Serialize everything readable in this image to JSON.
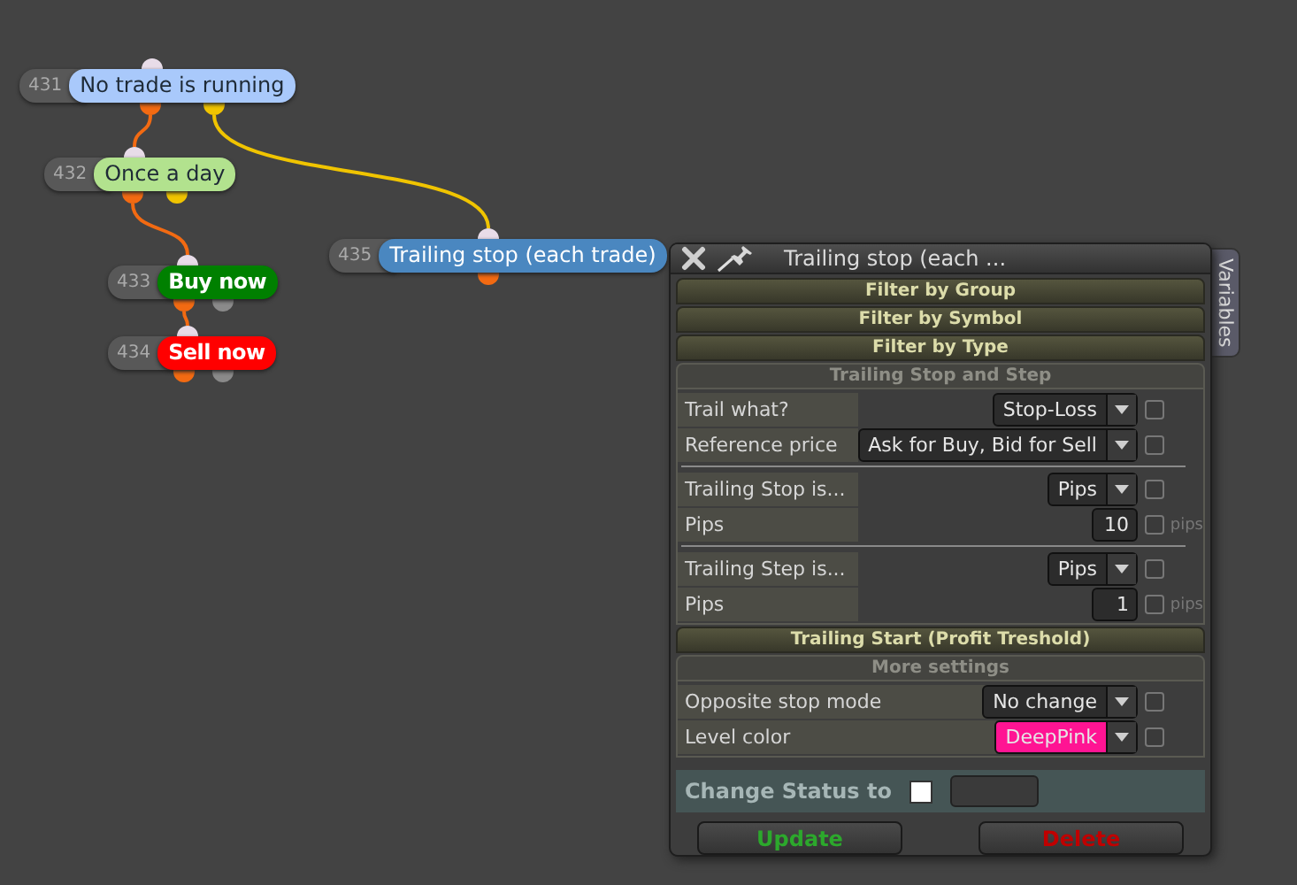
{
  "nodes": [
    {
      "number": "431",
      "label": "No trade is running",
      "color": "#a9c9fb",
      "bold": false,
      "outputs": [
        {
          "color": "#f26a12"
        },
        {
          "color": "#f0c400"
        }
      ]
    },
    {
      "number": "432",
      "label": "Once a day",
      "color": "#b2e28e",
      "bold": false,
      "outputs": [
        {
          "color": "#f26a12"
        },
        {
          "color": "#f0c400"
        }
      ]
    },
    {
      "number": "433",
      "label": "Buy now",
      "color": "#008000",
      "bold": true,
      "outputs": [
        {
          "color": "#f26a12"
        },
        {
          "color": "#8a8a8a"
        }
      ]
    },
    {
      "number": "434",
      "label": "Sell now",
      "color": "#ff0000",
      "bold": true,
      "outputs": [
        {
          "color": "#f26a12"
        },
        {
          "color": "#8a8a8a"
        }
      ]
    },
    {
      "number": "435",
      "label": "Trailing stop (each trade)",
      "color": "#4a87c0",
      "bold": false,
      "outputs": [
        {
          "color": "#f26a12"
        }
      ]
    }
  ],
  "panel": {
    "title": "Trailing stop (each ...",
    "side_tab": "Variables",
    "sections": [
      {
        "title": "Filter by Group",
        "expanded": false
      },
      {
        "title": "Filter by Symbol",
        "expanded": false
      },
      {
        "title": "Filter by Type",
        "expanded": false
      },
      {
        "title": "Trailing Stop and Step",
        "expanded": true,
        "groups": [
          [
            {
              "label": "Trail what?",
              "kind": "select",
              "value": "Stop-Loss",
              "checked": false
            },
            {
              "label": "Reference price",
              "kind": "select",
              "value": "Ask for Buy, Bid for Sell",
              "checked": false
            }
          ],
          [
            {
              "label": "Trailing Stop is...",
              "kind": "select",
              "value": "Pips",
              "checked": false
            },
            {
              "label": "Pips",
              "kind": "number",
              "value": "10",
              "unit": "pips",
              "checked": false
            }
          ],
          [
            {
              "label": "Trailing Step is...",
              "kind": "select",
              "value": "Pips",
              "checked": false
            },
            {
              "label": "Pips",
              "kind": "number",
              "value": "1",
              "unit": "pips",
              "checked": false
            }
          ]
        ]
      },
      {
        "title": "Trailing Start (Profit Treshold)",
        "expanded": false
      },
      {
        "title": "More settings",
        "expanded": true,
        "groups": [
          [
            {
              "label": "Opposite stop mode",
              "kind": "select",
              "value": "No change",
              "checked": false
            },
            {
              "label": "Level color",
              "kind": "select",
              "value": "DeepPink",
              "color": "#ff1493",
              "checked": false
            }
          ]
        ]
      }
    ],
    "status": {
      "label": "Change Status to",
      "checked": false
    },
    "buttons": [
      {
        "label": "Update",
        "kind": "update"
      },
      {
        "label": "Delete",
        "kind": "delete"
      }
    ]
  }
}
